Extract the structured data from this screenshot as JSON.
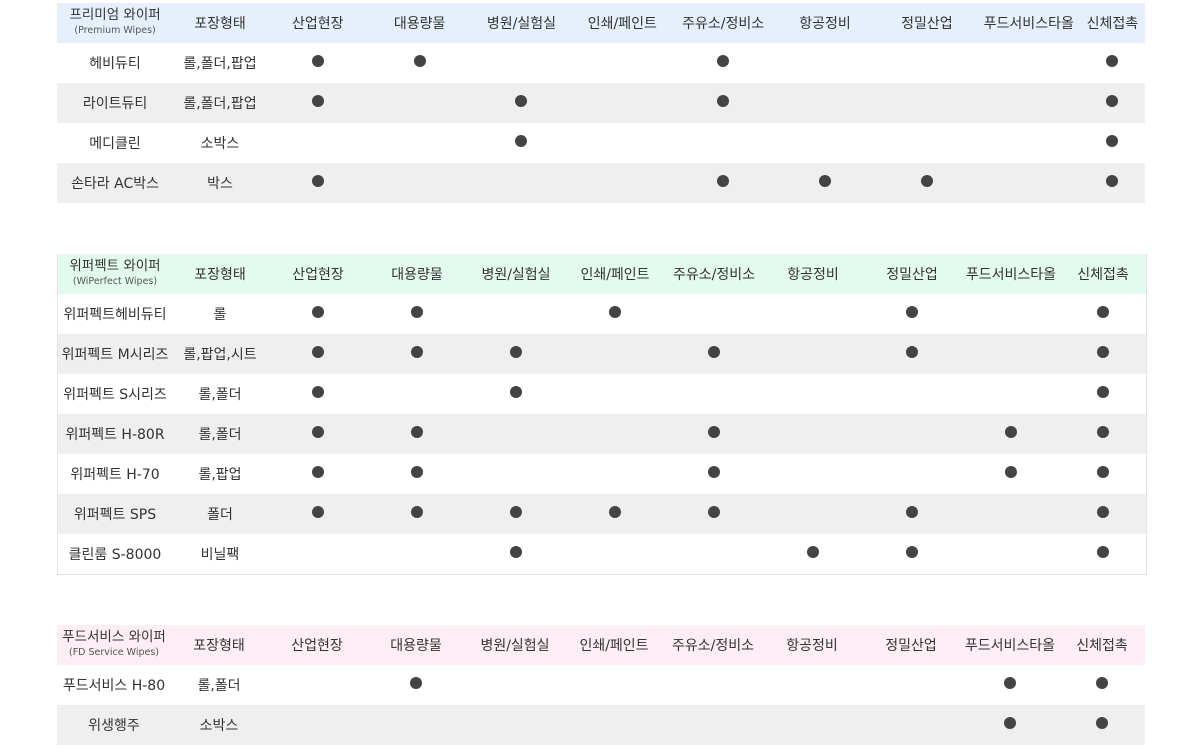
{
  "columns": [
    "포장형태",
    "산업현장",
    "대용량물",
    "병원/실험실",
    "인쇄/페인트",
    "주유소/정비소",
    "항공정비",
    "정밀산업",
    "푸드서비스타올",
    "신체접촉"
  ],
  "sections": [
    {
      "id": "premium",
      "title": "프리미엄 와이퍼",
      "subtitle": "(Premium Wipes)",
      "rows": [
        {
          "name": "헤비듀티",
          "pack": "롤,폴더,팝업",
          "marks": [
            1,
            1,
            0,
            0,
            1,
            0,
            0,
            0,
            1
          ]
        },
        {
          "name": "라이트듀티",
          "pack": "롤,폴더,팝업",
          "marks": [
            1,
            0,
            1,
            0,
            1,
            0,
            0,
            0,
            1
          ]
        },
        {
          "name": "메디클린",
          "pack": "소박스",
          "marks": [
            0,
            0,
            1,
            0,
            0,
            0,
            0,
            0,
            1
          ]
        },
        {
          "name": "손타라 AC박스",
          "pack": "박스",
          "marks": [
            1,
            0,
            0,
            0,
            1,
            1,
            1,
            0,
            1
          ]
        }
      ]
    },
    {
      "id": "wiperfect",
      "title": "위퍼펙트 와이퍼",
      "subtitle": "(WiPerfect Wipes)",
      "rows": [
        {
          "name": "위퍼펙트헤비듀티",
          "pack": "롤",
          "marks": [
            1,
            1,
            0,
            1,
            0,
            0,
            1,
            0,
            1
          ]
        },
        {
          "name": "위퍼펙트 M시리즈",
          "pack": "롤,팝업,시트",
          "marks": [
            1,
            1,
            1,
            0,
            1,
            0,
            1,
            0,
            1
          ]
        },
        {
          "name": "위퍼펙트 S시리즈",
          "pack": "롤,폴더",
          "marks": [
            1,
            0,
            1,
            0,
            0,
            0,
            0,
            0,
            1
          ]
        },
        {
          "name": "위퍼펙트 H-80R",
          "pack": "롤,폴더",
          "marks": [
            1,
            1,
            0,
            0,
            1,
            0,
            0,
            1,
            1
          ]
        },
        {
          "name": "위퍼펙트 H-70",
          "pack": "롤,팝업",
          "marks": [
            1,
            1,
            0,
            0,
            1,
            0,
            0,
            1,
            1
          ]
        },
        {
          "name": "위퍼펙트 SPS",
          "pack": "폴더",
          "marks": [
            1,
            1,
            1,
            1,
            1,
            0,
            1,
            0,
            1
          ]
        },
        {
          "name": "클린룸 S-8000",
          "pack": "비닐팩",
          "marks": [
            0,
            0,
            1,
            0,
            0,
            1,
            1,
            0,
            1
          ]
        }
      ]
    },
    {
      "id": "fd",
      "title": "푸드서비스 와이퍼",
      "subtitle": "(FD Service Wipes)",
      "rows": [
        {
          "name": "푸드서비스 H-80",
          "pack": "롤,폴더",
          "marks": [
            0,
            1,
            0,
            0,
            0,
            0,
            0,
            1,
            1
          ]
        },
        {
          "name": "위생행주",
          "pack": "소박스",
          "marks": [
            0,
            0,
            0,
            0,
            0,
            0,
            0,
            1,
            1
          ]
        }
      ]
    }
  ],
  "colors": {
    "premium_header": "#e6f0fc",
    "wiperfect_header": "#e3faee",
    "fd_header": "#fdeef5",
    "row_alt": "#efefef",
    "dot": "#444444"
  }
}
